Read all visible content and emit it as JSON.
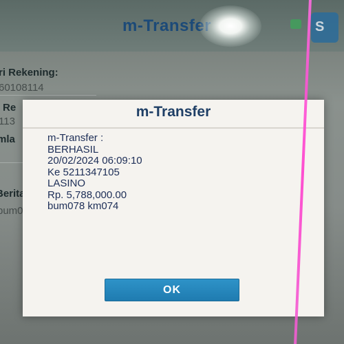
{
  "background_screen": {
    "title": "m-Transfer",
    "side_icon_text": "S",
    "fields": [
      {
        "label": "ri Rekening:",
        "value": "60108114"
      },
      {
        "label": "Re",
        "value": "113"
      },
      {
        "label": "mla",
        "value": ""
      },
      {
        "label": "Berita",
        "value": "bum0"
      }
    ]
  },
  "dialog": {
    "title": "m-Transfer",
    "message_lines": [
      "m-Transfer :",
      "BERHASIL",
      "20/02/2024 06:09:10",
      "Ke 5211347105",
      "LASINO",
      "Rp. 5,788,000.00",
      "bum078 km074"
    ],
    "ok_label": "OK"
  },
  "colors": {
    "dialog_background": "#f5f3ef",
    "title_text": "#1f3f66",
    "message_text": "#1d2e57",
    "ok_button": "#2383bb",
    "laser_line": "#ff3ccc"
  }
}
